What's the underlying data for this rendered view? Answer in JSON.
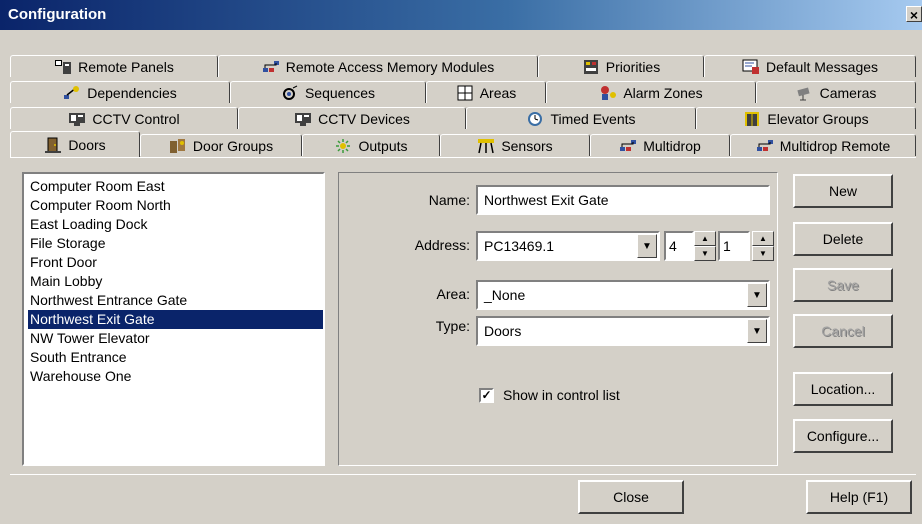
{
  "window": {
    "title": "Configuration",
    "close_glyph": "×"
  },
  "tabs": {
    "row1": [
      {
        "label": "Remote Panels",
        "icon": "remote-panel-icon"
      },
      {
        "label": "Remote Access Memory Modules",
        "icon": "network-icon"
      },
      {
        "label": "Priorities",
        "icon": "priorities-icon"
      },
      {
        "label": "Default Messages",
        "icon": "messages-icon"
      }
    ],
    "row2": [
      {
        "label": "Dependencies",
        "icon": "dependencies-icon"
      },
      {
        "label": "Sequences",
        "icon": "sequences-icon"
      },
      {
        "label": "Areas",
        "icon": "areas-icon"
      },
      {
        "label": "Alarm Zones",
        "icon": "alarm-zones-icon"
      },
      {
        "label": "Cameras",
        "icon": "camera-icon"
      }
    ],
    "row3": [
      {
        "label": "CCTV Control",
        "icon": "cctv-icon"
      },
      {
        "label": "CCTV Devices",
        "icon": "cctv-icon"
      },
      {
        "label": "Timed Events",
        "icon": "clock-icon"
      },
      {
        "label": "Elevator Groups",
        "icon": "elevator-icon"
      }
    ],
    "row4": [
      {
        "label": "Doors",
        "icon": "door-icon",
        "active": true
      },
      {
        "label": "Door Groups",
        "icon": "door-groups-icon"
      },
      {
        "label": "Outputs",
        "icon": "outputs-icon"
      },
      {
        "label": "Sensors",
        "icon": "sensors-icon"
      },
      {
        "label": "Multidrop",
        "icon": "network-icon"
      },
      {
        "label": "Multidrop Remote",
        "icon": "network-icon"
      }
    ]
  },
  "door_list": {
    "items": [
      "Computer Room East",
      "Computer Room North",
      "East Loading Dock",
      "File Storage",
      "Front Door",
      "Main Lobby",
      "Northwest Entrance Gate",
      "Northwest Exit Gate",
      "NW Tower Elevator",
      "South Entrance",
      "Warehouse One"
    ],
    "selected": "Northwest Exit Gate"
  },
  "form": {
    "name_label": "Name:",
    "name_value": "Northwest Exit Gate",
    "address_label": "Address:",
    "address_value": "PC13469.1",
    "address_spin1": "4",
    "address_spin2": "1",
    "area_label": "Area:",
    "area_value": "_None",
    "type_label": "Type:",
    "type_value": "Doors",
    "show_in_control_list_label": "Show in control list",
    "show_in_control_list_checked": true
  },
  "buttons": {
    "new": "New",
    "delete": "Delete",
    "save": "Save",
    "cancel": "Cancel",
    "location": "Location...",
    "configure": "Configure...",
    "close": "Close",
    "help": "Help (F1)"
  },
  "colors": {
    "face": "#d4d0c8",
    "selection": "#0a246a",
    "title_start": "#0a246a",
    "title_end": "#a6caf0"
  }
}
